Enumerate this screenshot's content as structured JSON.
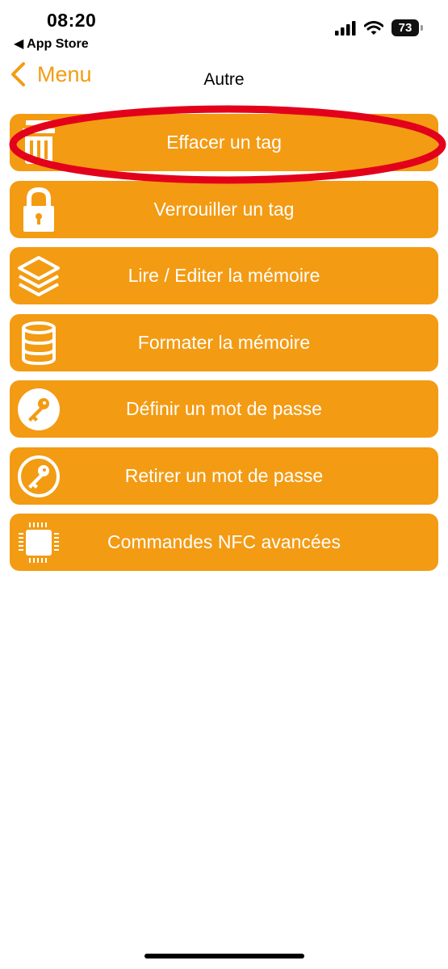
{
  "status_bar": {
    "time": "08:20",
    "back_app": "◀ App Store",
    "battery": "73"
  },
  "nav": {
    "back_label": "Menu",
    "title": "Autre"
  },
  "menu": {
    "items": [
      {
        "label": "Effacer un tag",
        "icon": "trash-icon"
      },
      {
        "label": "Verrouiller un tag",
        "icon": "lock-icon"
      },
      {
        "label": "Lire / Editer la mémoire",
        "icon": "layers-icon"
      },
      {
        "label": "Formater la mémoire",
        "icon": "database-icon"
      },
      {
        "label": "Définir un mot de passe",
        "icon": "key-icon"
      },
      {
        "label": "Retirer un mot de passe",
        "icon": "key-outline-icon"
      },
      {
        "label": "Commandes NFC avancées",
        "icon": "chip-icon"
      }
    ]
  },
  "colors": {
    "accent": "#f39b13",
    "highlight": "#e3001b"
  }
}
